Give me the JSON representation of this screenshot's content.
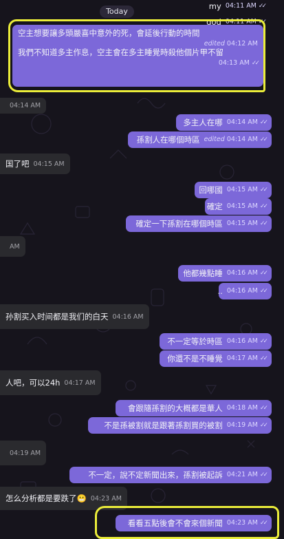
{
  "date_pill": "Today",
  "messages": [
    {
      "dir": "out",
      "text": "my",
      "time": "04:11 AM",
      "edited": false,
      "read": true
    },
    {
      "dir": "out",
      "text": "god",
      "time": "04:11 AM",
      "edited": false,
      "read": true
    },
    {
      "dir": "out",
      "text": "空主想要讓多頭嚴喜中意外的死，會延後行動的時間",
      "time": "04:12 AM",
      "edited": true,
      "read": false
    },
    {
      "dir": "out",
      "text": "我們不知道多主作息，空主會在多主睡覺時殺他個片甲不留",
      "time": "04:13 AM",
      "edited": false,
      "read": true
    },
    {
      "dir": "in",
      "text": "",
      "time": "04:14 AM",
      "edited": false
    },
    {
      "dir": "out",
      "text": "多主人在哪",
      "time": "04:14 AM",
      "edited": false,
      "read": true
    },
    {
      "dir": "out",
      "text": "孫割人在哪個時區",
      "time": "04:14 AM",
      "edited": true,
      "read": true
    },
    {
      "dir": "in",
      "text": "国了吧",
      "time": "04:15 AM",
      "edited": false
    },
    {
      "dir": "out",
      "text": "回哪國",
      "time": "04:15 AM",
      "edited": false,
      "read": true
    },
    {
      "dir": "out",
      "text": "確定",
      "time": "04:15 AM",
      "edited": false,
      "read": true
    },
    {
      "dir": "out",
      "text": "確定一下孫割在哪個時區",
      "time": "04:15 AM",
      "edited": false,
      "read": true
    },
    {
      "dir": "in",
      "text": "",
      "time": "AM",
      "edited": false
    },
    {
      "dir": "out",
      "text": "他都幾點睡",
      "time": "04:16 AM",
      "edited": false,
      "read": true
    },
    {
      "dir": "out",
      "text": "..",
      "time": "04:16 AM",
      "edited": false,
      "read": true
    },
    {
      "dir": "in",
      "text": "孙割买入时间都是我们的白天",
      "time": "04:16 AM",
      "edited": false
    },
    {
      "dir": "out",
      "text": "不一定等於時區",
      "time": "04:16 AM",
      "edited": false,
      "read": true
    },
    {
      "dir": "out",
      "text": "你還不是不睡覺",
      "time": "04:17 AM",
      "edited": false,
      "read": true
    },
    {
      "dir": "in",
      "text": "人吧，可以24h",
      "time": "04:17 AM",
      "edited": false
    },
    {
      "dir": "out",
      "text": "會跟隨孫割的大概都是華人",
      "time": "04:18 AM",
      "edited": false,
      "read": true
    },
    {
      "dir": "out",
      "text": "不是孫被割就是跟著孫割買的被割",
      "time": "04:19 AM",
      "edited": false,
      "read": true
    },
    {
      "dir": "in",
      "text": "",
      "time": "04:19 AM",
      "edited": false
    },
    {
      "dir": "out",
      "text": "不一定，說不定新聞出來，孫割被起訴",
      "time": "04:21 AM",
      "edited": false,
      "read": true
    },
    {
      "dir": "in",
      "text": "怎么分析都是要跌了",
      "emoji": "😬",
      "time": "04:23 AM",
      "edited": false
    },
    {
      "dir": "out",
      "text": "看看五點後會不會來個新聞",
      "time": "04:23 AM",
      "edited": false,
      "read": true
    }
  ],
  "labels": {
    "edited": "edited"
  },
  "colors": {
    "outgoing": "#7c68d9",
    "incoming": "#2a2a2e",
    "highlight": "#ecee3a",
    "background": "#16141c"
  },
  "icons": {
    "read": "double-check-icon",
    "sent": "single-check-icon"
  }
}
